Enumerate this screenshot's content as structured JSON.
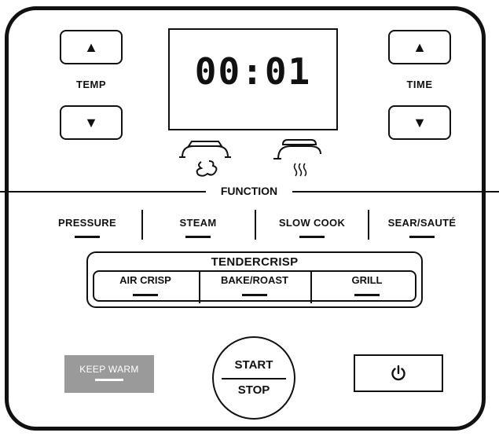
{
  "temp": {
    "label": "TEMP",
    "up_icon": "▲",
    "down_icon": "▼"
  },
  "time": {
    "label": "TIME",
    "up_icon": "▲",
    "down_icon": "▼"
  },
  "display": {
    "value": "00:01"
  },
  "function": {
    "label": "FUNCTION",
    "items": [
      {
        "label": "PRESSURE"
      },
      {
        "label": "STEAM"
      },
      {
        "label": "SLOW COOK"
      },
      {
        "label": "SEAR/SAUTÉ"
      }
    ]
  },
  "tendercrisp": {
    "title": "TENDERCRISP",
    "items": [
      {
        "label": "AIR CRISP"
      },
      {
        "label": "BAKE/ROAST"
      },
      {
        "label": "GRILL"
      }
    ]
  },
  "keep_warm": {
    "label": "KEEP WARM"
  },
  "start_stop": {
    "top": "START",
    "bottom": "STOP"
  },
  "power": {
    "icon": "power-icon"
  },
  "colors": {
    "keep_warm_bg": "#9a9a9a",
    "outline": "#111111"
  }
}
